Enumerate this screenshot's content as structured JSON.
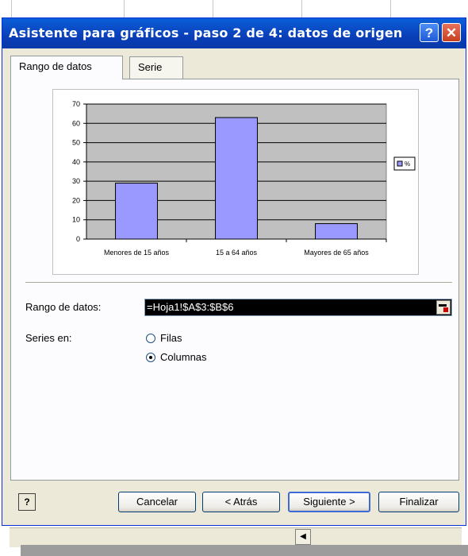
{
  "dialog": {
    "title": "Asistente para gráficos - paso 2 de 4: datos de origen",
    "help_glyph": "?",
    "close_glyph": "✕"
  },
  "tabs": [
    {
      "label": "Rango de datos",
      "active": true
    },
    {
      "label": "Serie",
      "active": false
    }
  ],
  "chart_data": {
    "type": "bar",
    "categories": [
      "Menores de 15 años",
      "15 a 64 años",
      "Mayores de 65 años"
    ],
    "series": [
      {
        "name": "%",
        "values": [
          29,
          63,
          8
        ],
        "color": "#9999ff"
      }
    ],
    "ylim": [
      0,
      70
    ],
    "yticks": [
      "0",
      "10",
      "20",
      "30",
      "40",
      "50",
      "60",
      "70"
    ],
    "grid": true,
    "plot_background": "#c0c0c0",
    "legend_position": "right"
  },
  "form": {
    "range_label": "Rango de datos:",
    "range_value": "=Hoja1!$A$3:$B$6",
    "series_label": "Series en:",
    "options": [
      {
        "label": "Filas",
        "selected": false
      },
      {
        "label": "Columnas",
        "selected": true
      }
    ]
  },
  "buttons": {
    "help": "?",
    "cancel": "Cancelar",
    "back": "< Atrás",
    "next": "Siguiente >",
    "finish": "Finalizar"
  },
  "sheet": {
    "scroll_arrow": "◀"
  }
}
